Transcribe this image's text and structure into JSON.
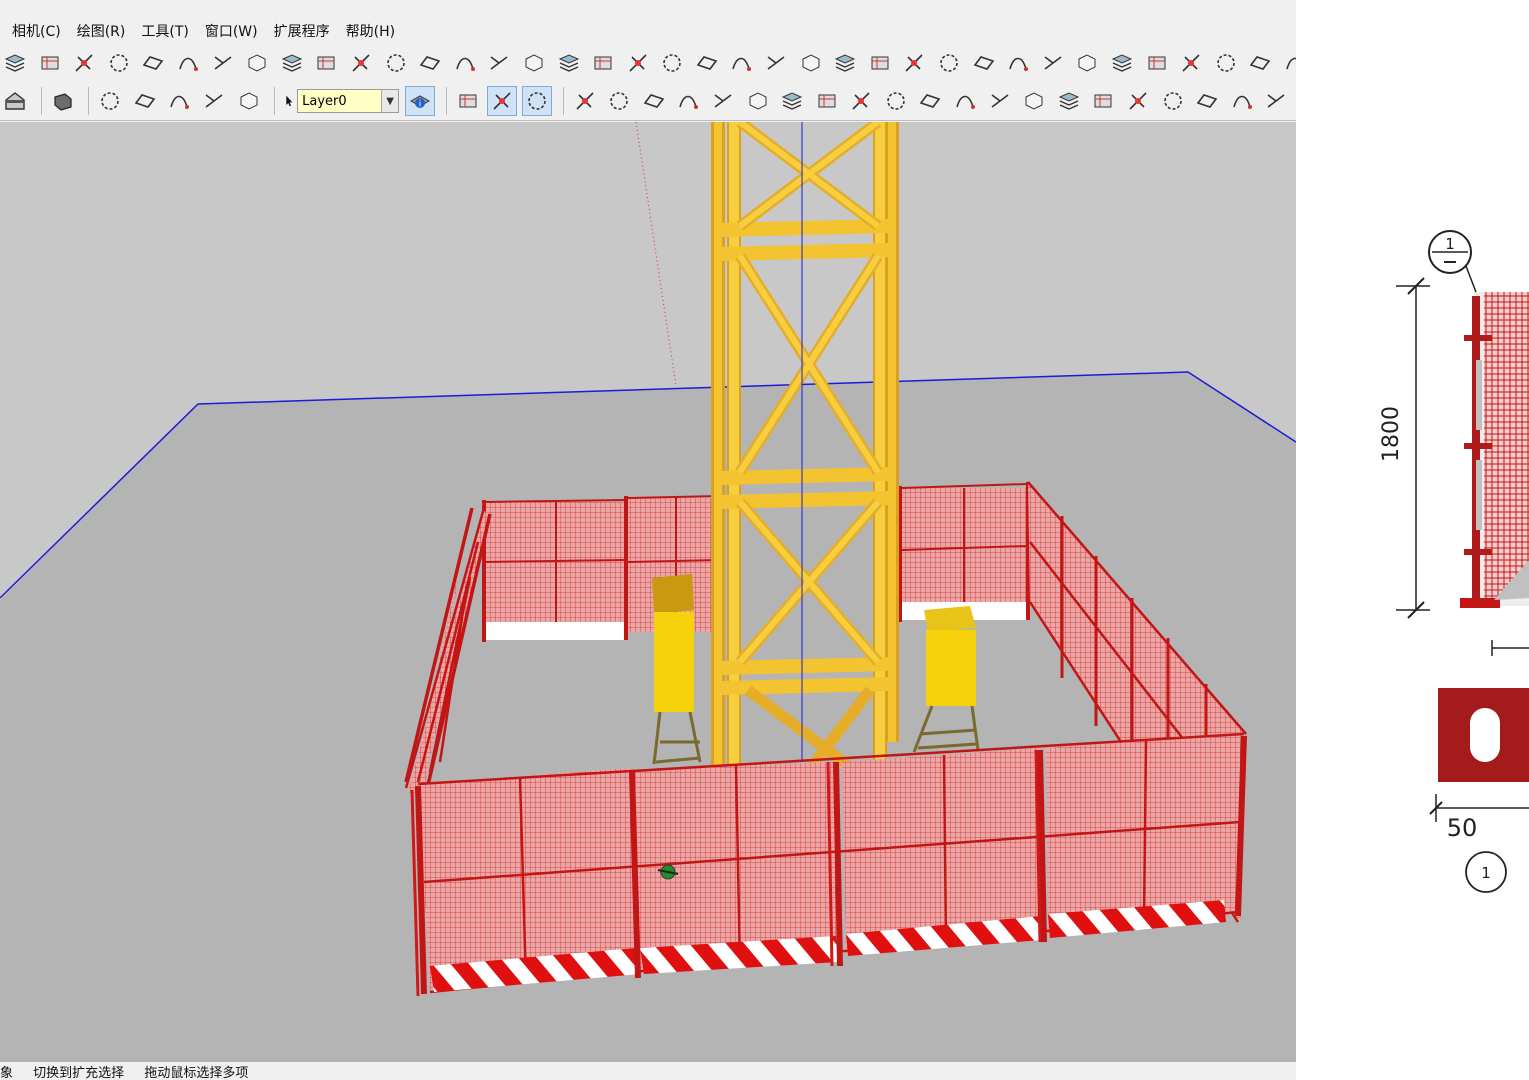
{
  "menu": {
    "items": [
      "相机(C)",
      "绘图(R)",
      "工具(T)",
      "窗口(W)",
      "扩展程序",
      "帮助(H)"
    ]
  },
  "layer": {
    "current": "Layer0"
  },
  "status": {
    "hint_prefix": "象",
    "hint_toggle": "切换到扩充选择",
    "hint_drag": "拖动鼠标选择多项"
  },
  "drawing": {
    "callout": "1",
    "height_dim": "1800",
    "width_dim": "50",
    "section_label": "1"
  },
  "colors": {
    "fence_red": "#d01818",
    "tower_yellow": "#f4c430",
    "ground": "#b4b4b4",
    "sky": "#c8c8c8",
    "axis_blue": "#1c1cd8"
  },
  "toolbar_icons": {
    "row1": [
      "layers-icon",
      "layer-manager-icon",
      "eraser-icon",
      "rotate-icon",
      "offset-icon",
      "follow-me-icon",
      "curve-icon",
      "3d-box-icon",
      "cut-icon",
      "intersect-icon",
      "arrow-icon",
      "line-icon",
      "corner-icon",
      "angle-icon",
      "arc-icon",
      "wall-icon",
      "roof-icon",
      "paint-icon",
      "column-icon",
      "grid-icon",
      "hand-icon",
      "stair-icon",
      "door-icon",
      "window-icon",
      "truss-icon",
      "drill-icon",
      "push-icon",
      "scissor-icon",
      "split-icon",
      "slope-icon",
      "panel-icon",
      "flag-icon",
      "facade-icon",
      "rail-icon",
      "hatch-icon",
      "stripe-icon",
      "shell-icon",
      "more-icon"
    ],
    "row2": [
      "home-icon",
      "solid-icon",
      "union-icon",
      "subtract-icon",
      "trim-icon",
      "split-solid-icon",
      "outer-shell-icon",
      "axes-icon",
      "xray-icon",
      "section-icon",
      "box-tool-icon",
      "surface-icon",
      "extrude-icon",
      "array-icon",
      "fence-icon",
      "panel2-icon",
      "cut2-icon",
      "bend-icon",
      "check-icon",
      "curve2-icon",
      "check2-icon",
      "arc2-icon",
      "plane-icon",
      "bucket-icon",
      "path-icon",
      "angle2-icon",
      "cube-red-icon",
      "3d-model-icon",
      "triangle-icon",
      "move-red-icon",
      "arc3-icon"
    ]
  }
}
